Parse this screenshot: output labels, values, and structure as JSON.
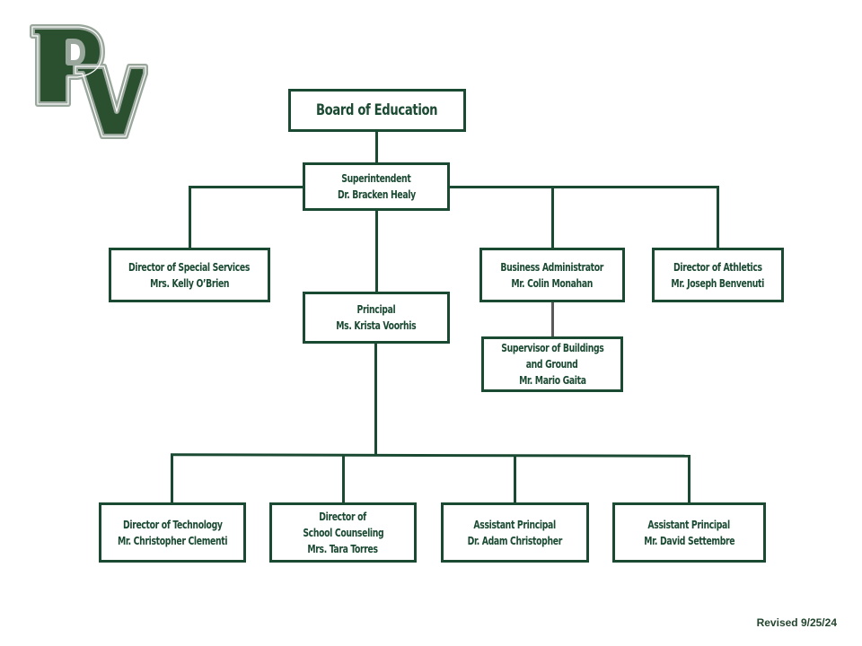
{
  "logo": {
    "text": "PV",
    "fill": "#2b5030",
    "outline": "#9aa79c"
  },
  "colors": {
    "line": "#1b4a33",
    "text": "#1b4a33",
    "subconnector": "#5a5a5a"
  },
  "nodes": {
    "board": {
      "lines": [
        "Board of Education"
      ]
    },
    "superintendent": {
      "lines": [
        "Superintendent",
        "Dr. Bracken Healy"
      ]
    },
    "special_services": {
      "lines": [
        "Director of Special Services",
        "Mrs. Kelly O’Brien"
      ]
    },
    "principal": {
      "lines": [
        "Principal",
        "Ms. Krista Voorhis"
      ]
    },
    "business_admin": {
      "lines": [
        "Business Administrator",
        "Mr. Colin Monahan"
      ]
    },
    "athletics": {
      "lines": [
        "Director of Athletics",
        "Mr. Joseph Benvenuti"
      ]
    },
    "buildings": {
      "lines": [
        "Supervisor of Buildings",
        "and Ground",
        "Mr. Mario Gaita"
      ]
    },
    "technology": {
      "lines": [
        "Director of Technology",
        "Mr. Christopher Clementi"
      ]
    },
    "counseling": {
      "lines": [
        "Director of",
        "School Counseling",
        "Mrs. Tara Torres"
      ]
    },
    "ap1": {
      "lines": [
        "Assistant Principal",
        "Dr. Adam Christopher"
      ]
    },
    "ap2": {
      "lines": [
        "Assistant Principal",
        "Mr. David Settembre"
      ]
    }
  },
  "footer": {
    "revised": "Revised 9/25/24"
  }
}
